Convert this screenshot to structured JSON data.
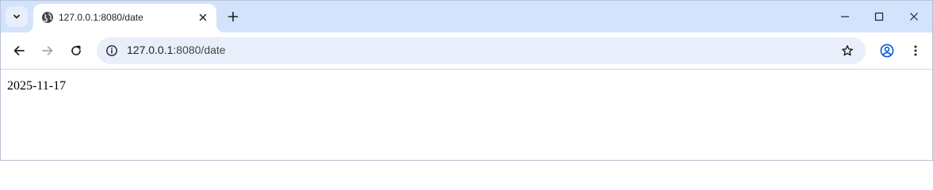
{
  "tab": {
    "title": "127.0.0.1:8080/date",
    "favicon": "globe-icon"
  },
  "toolbar": {
    "url_host": "127.0.0.1",
    "url_path": ":8080/date"
  },
  "page": {
    "text": "2025-11-17"
  },
  "colors": {
    "tabstrip": "#d3e3fd",
    "omnibox": "#e9effa",
    "profile_accent": "#0b57d0"
  }
}
